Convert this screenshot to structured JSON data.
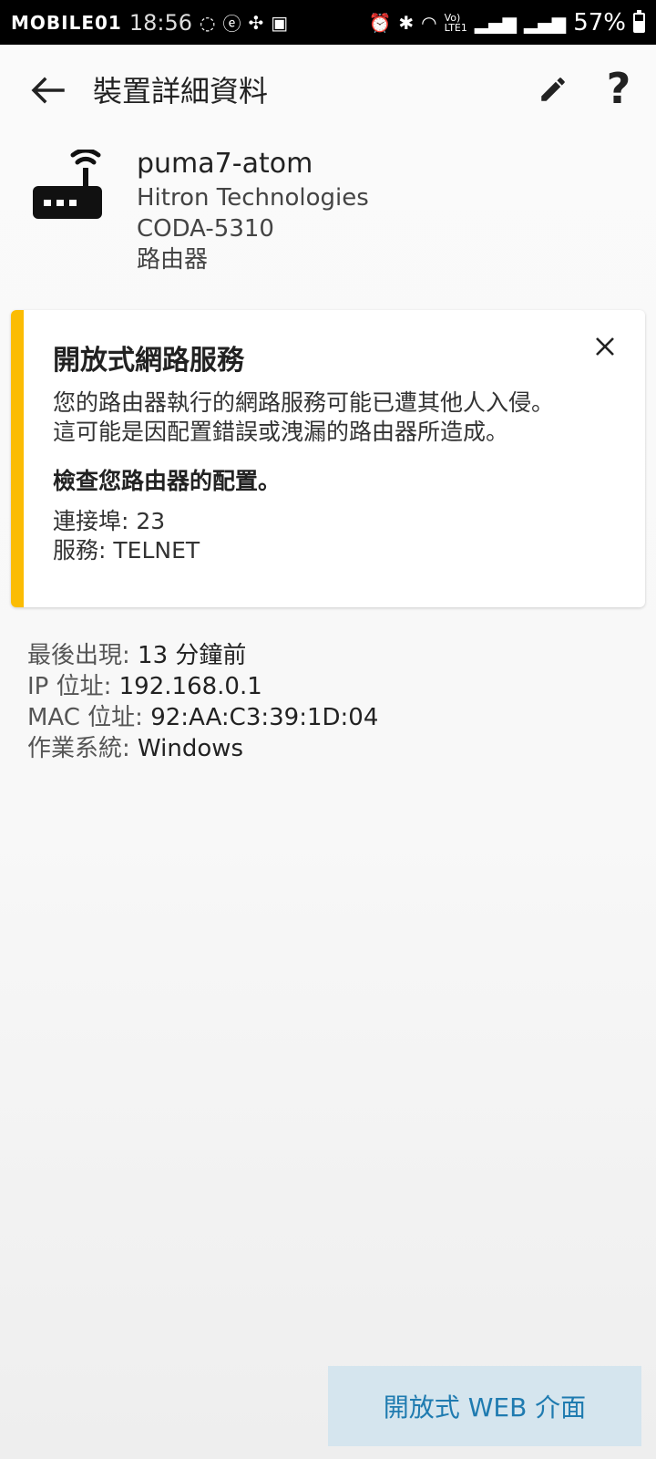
{
  "status_bar": {
    "watermark": "MOBILE01",
    "time": "18:56",
    "battery": "57%",
    "battery_level": 0.57,
    "icons": [
      "sync-icon",
      "e-icon",
      "fan-icon",
      "image-icon",
      "alarm-icon",
      "bluetooth-icon",
      "wifi-icon",
      "volte-icon",
      "signal-icon",
      "signal-icon",
      "battery-icon"
    ]
  },
  "appbar": {
    "title": "裝置詳細資料",
    "back_icon": "arrow-left-icon",
    "edit_icon": "pencil-icon",
    "help_label": "?"
  },
  "device": {
    "icon": "router-icon",
    "name": "puma7-atom",
    "vendor": "Hitron Technologies",
    "model": "CODA-5310",
    "type": "路由器"
  },
  "alert": {
    "accent_color": "#fbbc04",
    "title": "開放式網路服務",
    "body_line1": "您的路由器執行的網路服務可能已遭其他人入侵。",
    "body_line2": "這可能是因配置錯誤或洩漏的路由器所造成。",
    "action": "檢查您路由器的配置。",
    "port_label": "連接埠:",
    "port_value": "23",
    "service_label": "服務:",
    "service_value": "TELNET",
    "close_icon": "close-icon"
  },
  "info": {
    "last_seen_label": "最後出現:",
    "last_seen_value": "13 分鐘前",
    "ip_label": "IP 位址:",
    "ip_value": "192.168.0.1",
    "mac_label": "MAC 位址:",
    "mac_value": "92:AA:C3:39:1D:04",
    "os_label": "作業系統:",
    "os_value": "Windows"
  },
  "web_button": {
    "label": "開放式 WEB 介面",
    "color": "#1f7bb0"
  }
}
